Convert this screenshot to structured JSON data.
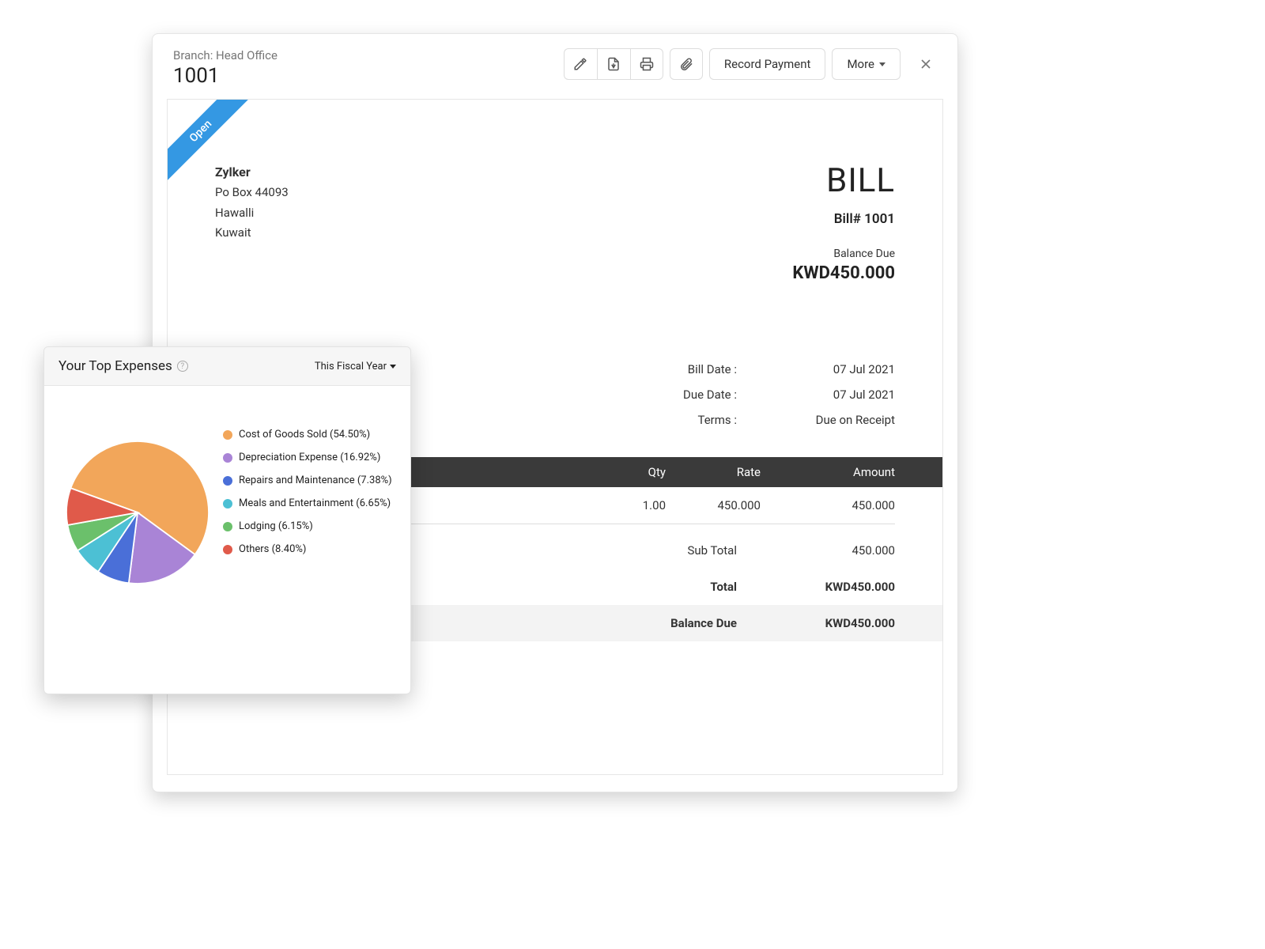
{
  "header": {
    "branch_label": "Branch: Head Office",
    "bill_number": "1001",
    "record_payment_label": "Record Payment",
    "more_label": "More"
  },
  "ribbon": {
    "status": "Open"
  },
  "company": {
    "name": "Zylker",
    "line1": "Po Box 44093",
    "line2": "Hawalli",
    "line3": "Kuwait"
  },
  "doc": {
    "title": "BILL",
    "number_label": "Bill# 1001",
    "balance_due_label": "Balance Due",
    "balance_due_amount": "KWD450.000"
  },
  "meta": {
    "bill_date_label": "Bill Date :",
    "bill_date_value": "07 Jul 2021",
    "due_date_label": "Due Date :",
    "due_date_value": "07 Jul 2021",
    "terms_label": "Terms :",
    "terms_value": "Due on Receipt"
  },
  "items": {
    "headers": {
      "qty": "Qty",
      "rate": "Rate",
      "amount": "Amount"
    },
    "row": {
      "qty": "1.00",
      "rate": "450.000",
      "amount": "450.000"
    }
  },
  "totals": {
    "subtotal_label": "Sub Total",
    "subtotal_value": "450.000",
    "total_label": "Total",
    "total_value": "KWD450.000",
    "balance_due_label": "Balance Due",
    "balance_due_value": "KWD450.000"
  },
  "expenses": {
    "title": "Your Top Expenses",
    "period": "This Fiscal Year",
    "legend": [
      {
        "label": "Cost of Goods Sold (54.50%)",
        "color": "#f2a65a"
      },
      {
        "label": "Depreciation Expense (16.92%)",
        "color": "#a984d6"
      },
      {
        "label": "Repairs and Maintenance (7.38%)",
        "color": "#4a6fd8"
      },
      {
        "label": "Meals and Entertainment (6.65%)",
        "color": "#4cc0d4"
      },
      {
        "label": "Lodging (6.15%)",
        "color": "#6bc06b"
      },
      {
        "label": "Others (8.40%)",
        "color": "#e05a4a"
      }
    ]
  },
  "chart_data": {
    "type": "pie",
    "title": "Your Top Expenses",
    "series": [
      {
        "name": "Cost of Goods Sold",
        "value": 54.5,
        "color": "#f2a65a"
      },
      {
        "name": "Depreciation Expense",
        "value": 16.92,
        "color": "#a984d6"
      },
      {
        "name": "Repairs and Maintenance",
        "value": 7.38,
        "color": "#4a6fd8"
      },
      {
        "name": "Meals and Entertainment",
        "value": 6.65,
        "color": "#4cc0d4"
      },
      {
        "name": "Lodging",
        "value": 6.15,
        "color": "#6bc06b"
      },
      {
        "name": "Others",
        "value": 8.4,
        "color": "#e05a4a"
      }
    ]
  }
}
